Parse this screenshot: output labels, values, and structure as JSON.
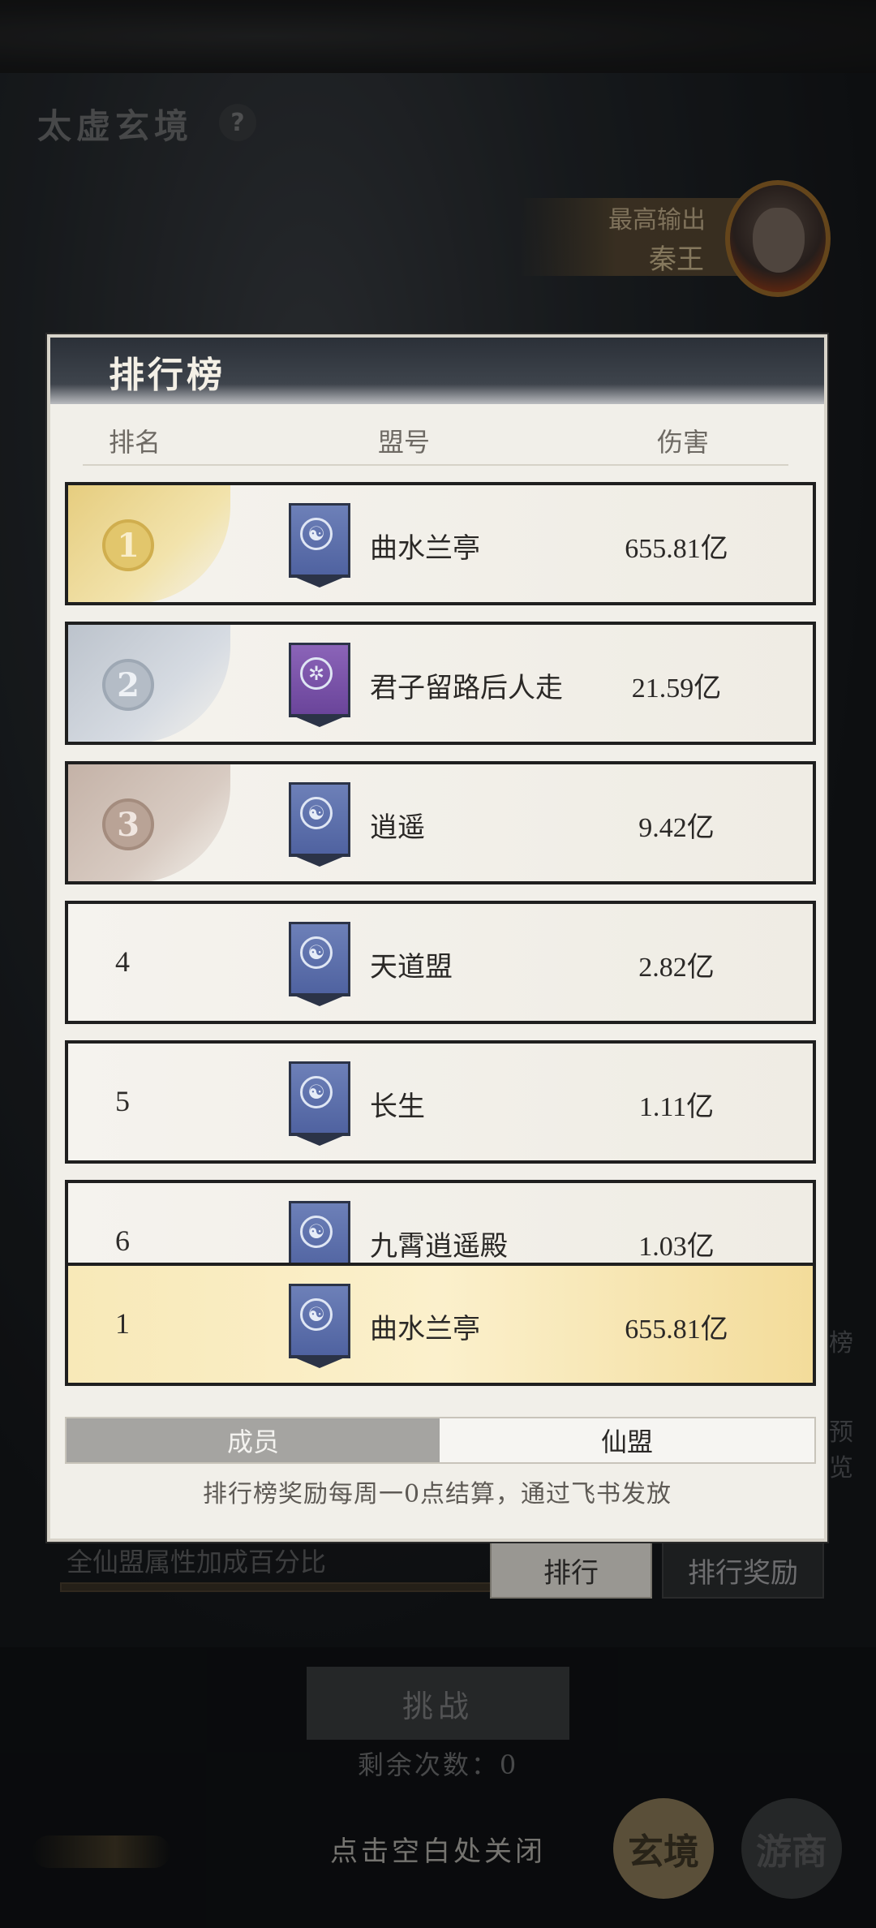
{
  "scene": {
    "title": "太虚玄境",
    "help": "?",
    "top_output_label": "最高输出",
    "top_output_name": "秦王",
    "side_tab_1": "榜",
    "side_tab_2": "预览",
    "bonus_label": "全仙盟属性加成百分比",
    "tab_rank": "排行",
    "tab_reward": "排行奖励",
    "challenge": "挑战",
    "remaining": "剩余次数：0",
    "close_hint": "点击空白处关闭",
    "nav_1": "玄境",
    "nav_2": "游商"
  },
  "leaderboard": {
    "title": "排行榜",
    "columns": {
      "rank": "排名",
      "union": "盟号",
      "damage": "伤害"
    },
    "rows": [
      {
        "rank": "1",
        "name": "曲水兰亭",
        "damage": "655.81亿",
        "medal": "gold",
        "banner": "blue"
      },
      {
        "rank": "2",
        "name": "君子留路后人走",
        "damage": "21.59亿",
        "medal": "silver",
        "banner": "purple"
      },
      {
        "rank": "3",
        "name": "逍遥",
        "damage": "9.42亿",
        "medal": "bronze",
        "banner": "blue"
      },
      {
        "rank": "4",
        "name": "天道盟",
        "damage": "2.82亿",
        "medal": "none",
        "banner": "blue"
      },
      {
        "rank": "5",
        "name": "长生",
        "damage": "1.11亿",
        "medal": "none",
        "banner": "blue"
      },
      {
        "rank": "6",
        "name": "九霄逍遥殿",
        "damage": "1.03亿",
        "medal": "none",
        "banner": "blue"
      }
    ],
    "self_row": {
      "rank": "1",
      "name": "曲水兰亭",
      "damage": "655.81亿",
      "banner": "blue"
    },
    "toggle_members": "成员",
    "toggle_union": "仙盟",
    "note": "排行榜奖励每周一0点结算，通过飞书发放"
  }
}
